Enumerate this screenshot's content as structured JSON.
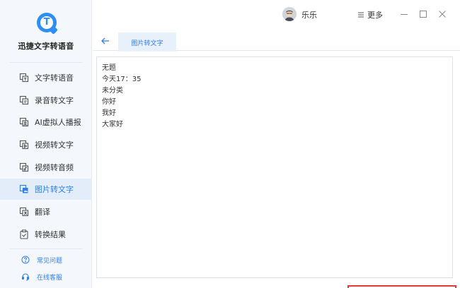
{
  "app": {
    "name": "迅捷文字转语音",
    "logo_letter": "T"
  },
  "sidebar": {
    "items": [
      {
        "label": "文字转语音",
        "icon": "text-to-speech-icon",
        "active": false
      },
      {
        "label": "录音转文字",
        "icon": "recording-to-text-icon",
        "active": false
      },
      {
        "label": "AI虚拟人播报",
        "icon": "virtual-anchor-icon",
        "active": false
      },
      {
        "label": "视频转文字",
        "icon": "video-to-text-icon",
        "active": false
      },
      {
        "label": "视频转音频",
        "icon": "video-to-audio-icon",
        "active": false
      },
      {
        "label": "图片转文字",
        "icon": "image-to-text-icon",
        "active": true
      },
      {
        "label": "翻译",
        "icon": "translate-icon",
        "active": false
      },
      {
        "label": "转换结果",
        "icon": "results-icon",
        "active": false
      }
    ],
    "footer": [
      {
        "label": "常见问题",
        "icon": "help-icon"
      },
      {
        "label": "在线客服",
        "icon": "headset-icon"
      }
    ]
  },
  "header": {
    "user_name": "乐乐",
    "more_label": "更多"
  },
  "tabs": [
    {
      "label": "图片转文字",
      "active": true
    }
  ],
  "result_lines": [
    "无题",
    "今天17：35",
    "未分类",
    "你好",
    "我好",
    "大家好"
  ],
  "colors": {
    "accent": "#2f7ee8",
    "sidebar_bg": "#f4f7fb",
    "highlight_border": "#e53935"
  }
}
